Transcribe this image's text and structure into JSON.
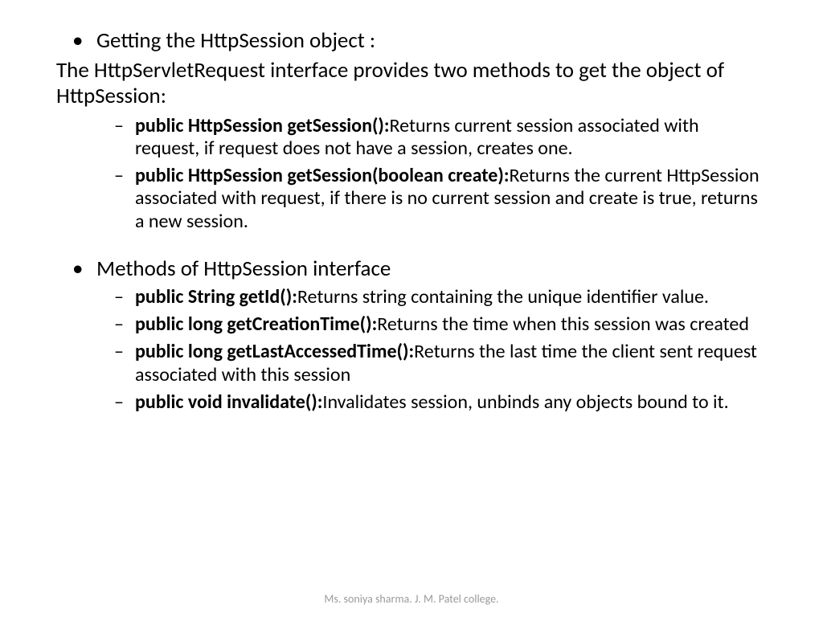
{
  "bullets": {
    "main1": "Getting the HttpSession object :",
    "para1": "The HttpServletRequest interface provides two methods to get the object of HttpSession:",
    "sub1_bold": "public HttpSession getSession():",
    "sub1_rest": "Returns current session associated with request, if request does not have a session, creates one.",
    "sub2_bold": "public HttpSession getSession(boolean create):",
    "sub2_rest": "Returns the current HttpSession associated with request, if there is no current session and create is true, returns a new session.",
    "main2": "Methods of HttpSession interface",
    "sub3_bold": "public String getId():",
    "sub3_rest": "Returns string containing the unique identifier value.",
    "sub4_bold": "public long getCreationTime():",
    "sub4_rest": "Returns the time when this session was created",
    "sub5_bold": "public long getLastAccessedTime():",
    "sub5_rest": "Returns the last time the client sent request associated with this session",
    "sub6_bold": "public void invalidate():",
    "sub6_rest": "Invalidates session, unbinds any objects bound to it."
  },
  "footer": "Ms. soniya sharma. J. M. Patel college."
}
